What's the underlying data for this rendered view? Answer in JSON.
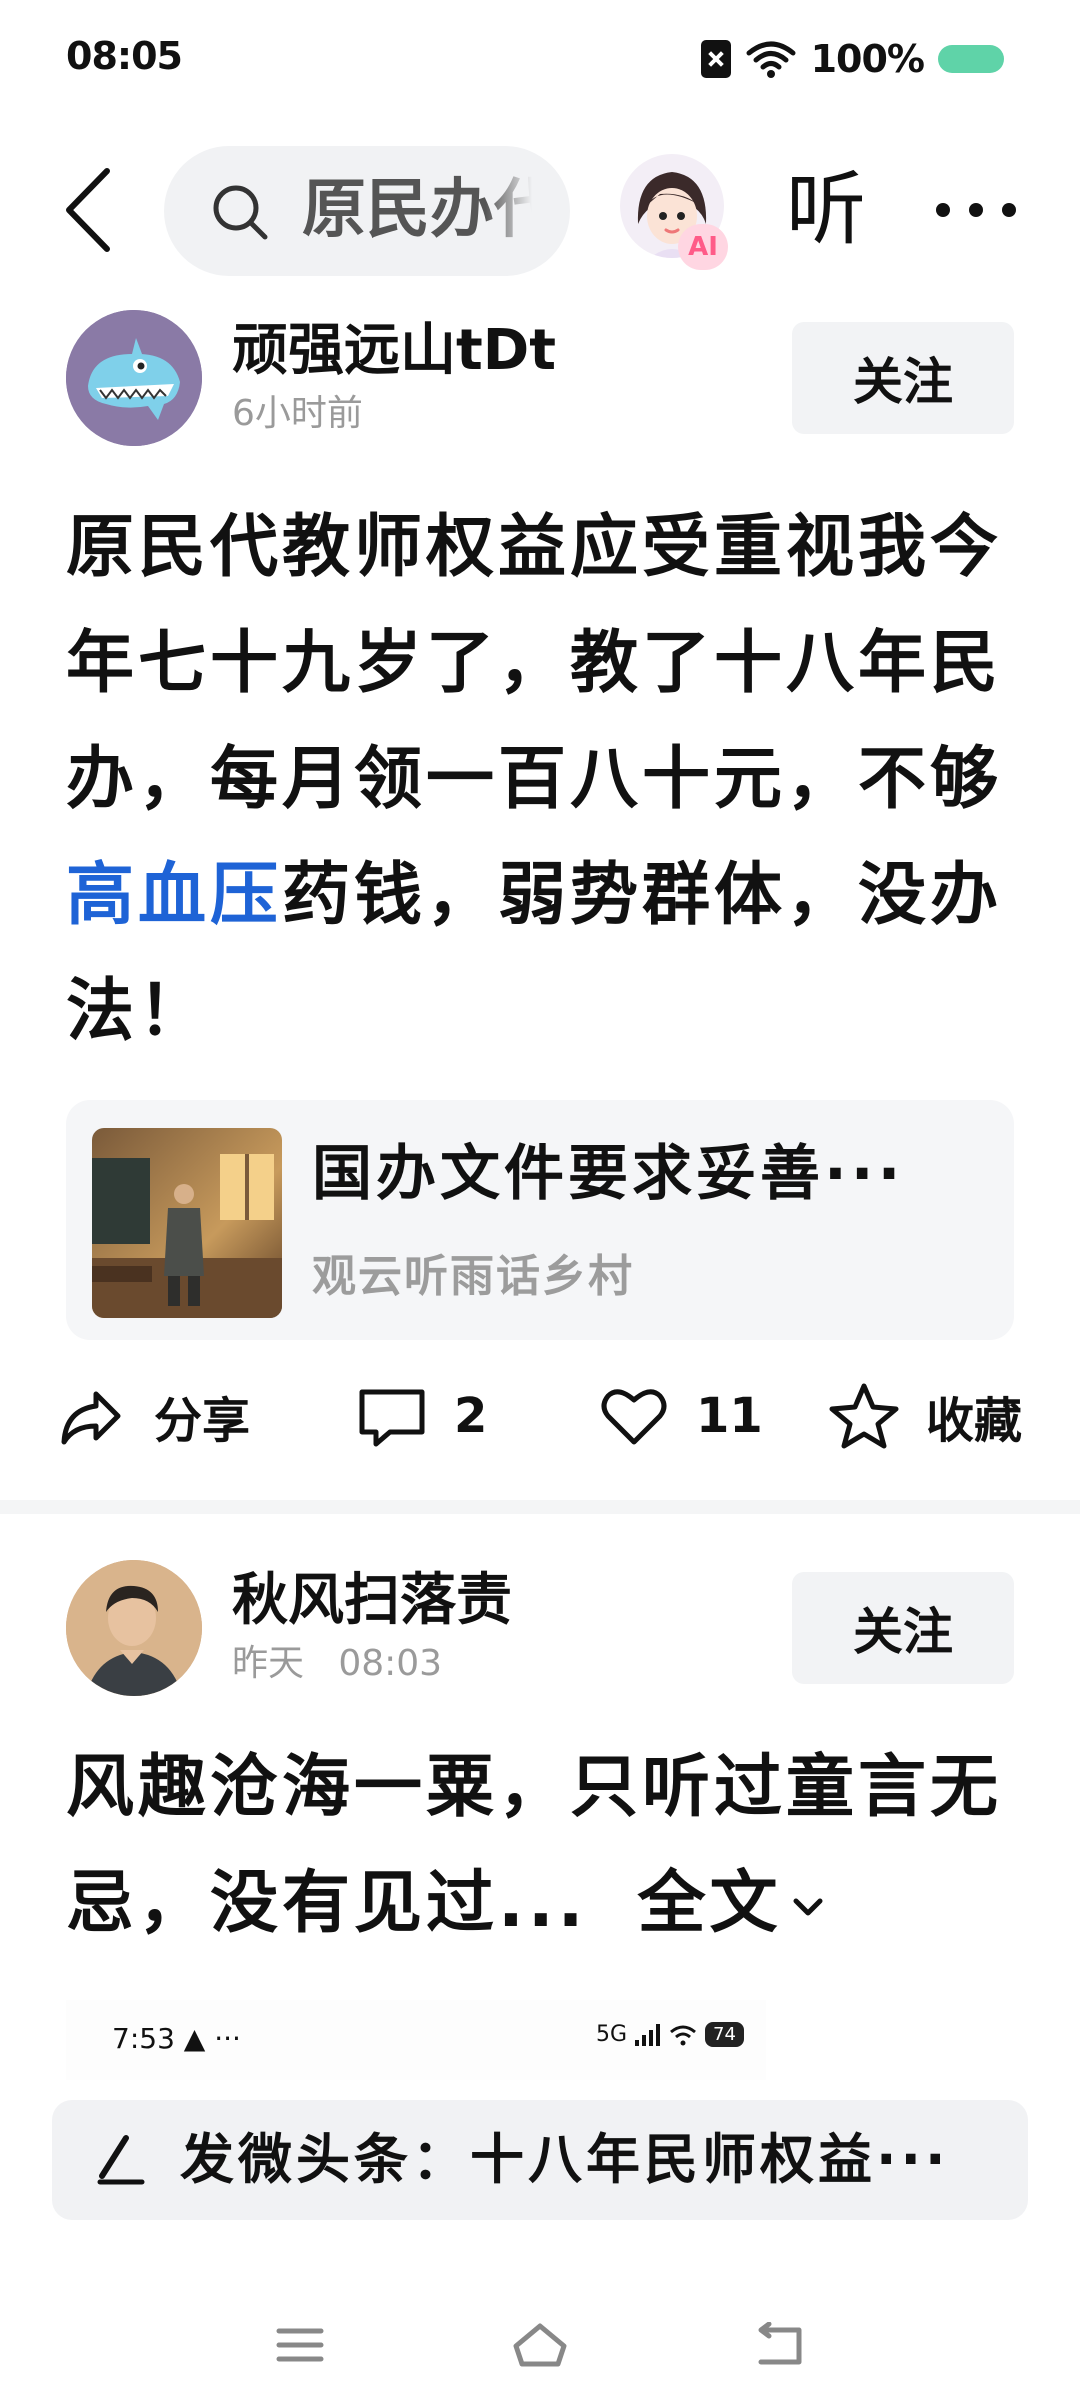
{
  "status_bar": {
    "time": "08:05",
    "battery": "100%",
    "battery_color": "#5fd3a8"
  },
  "nav": {
    "search_text": "原民办代",
    "ai_badge": "AI",
    "listen_label": "听"
  },
  "posts": [
    {
      "author": "顽强远山tDt",
      "time": "6小时前",
      "follow_label": "关注",
      "body_before": "原民代教师权益应受重视我今年七十九岁了，教了十八年民办，每月领一百八十元，不够",
      "body_link": "高血压",
      "body_after": "药钱，弱势群体，没办法！",
      "link_color": "#1e63d6",
      "article": {
        "title": "国办文件要求妥善···",
        "source": "观云听雨话乡村"
      },
      "actions": {
        "share": "分享",
        "comments": "2",
        "likes": "11",
        "favorite": "收藏"
      }
    },
    {
      "author": "秋风扫落责",
      "time": "昨天   08:03",
      "follow_label": "关注",
      "body": "风趣沧海一粟，只听过童言无忌，没有见过...",
      "expand_label": "全文",
      "embed_status": {
        "time": "7:53",
        "network": "5G",
        "battery": "74"
      }
    }
  ],
  "compose": {
    "text": "发微头条：十八年民师权益···"
  }
}
